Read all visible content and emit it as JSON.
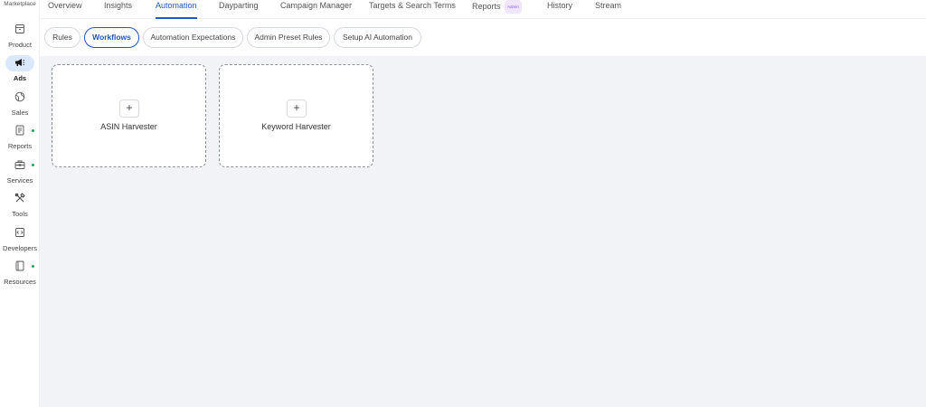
{
  "sidebar": {
    "header": "Marketplace",
    "items": [
      {
        "label": "Product",
        "icon": "box-icon"
      },
      {
        "label": "Ads",
        "icon": "megaphone-icon"
      },
      {
        "label": "Sales",
        "icon": "globe-icon"
      },
      {
        "label": "Reports",
        "icon": "document-icon"
      },
      {
        "label": "Services",
        "icon": "briefcase-icon"
      },
      {
        "label": "Tools",
        "icon": "tools-icon"
      },
      {
        "label": "Developers",
        "icon": "code-icon"
      },
      {
        "label": "Resources",
        "icon": "book-icon"
      }
    ],
    "active_color": "#dbe7fb",
    "status_dot_color": "#23a55a"
  },
  "topnav": {
    "tabs": [
      {
        "label": "Overview"
      },
      {
        "label": "Insights"
      },
      {
        "label": "Automation"
      },
      {
        "label": "Dayparting"
      },
      {
        "label": "Campaign Manager"
      },
      {
        "label": "Targets & Search Terms"
      },
      {
        "label": "Reports",
        "badge": "Admin"
      },
      {
        "label": "History"
      },
      {
        "label": "Stream"
      }
    ],
    "active_tab": "Automation",
    "accent_color": "#1f56c4"
  },
  "subtabs": {
    "items": [
      {
        "label": "Rules"
      },
      {
        "label": "Workflows"
      },
      {
        "label": "Automation Expectations"
      },
      {
        "label": "Admin Preset Rules"
      },
      {
        "label": "Setup AI Automation"
      }
    ],
    "active": "Workflows"
  },
  "workflows": {
    "cards": [
      {
        "title": "ASIN Harvester",
        "icon": "plus-icon"
      },
      {
        "title": "Keyword Harvester",
        "icon": "plus-icon"
      }
    ]
  }
}
